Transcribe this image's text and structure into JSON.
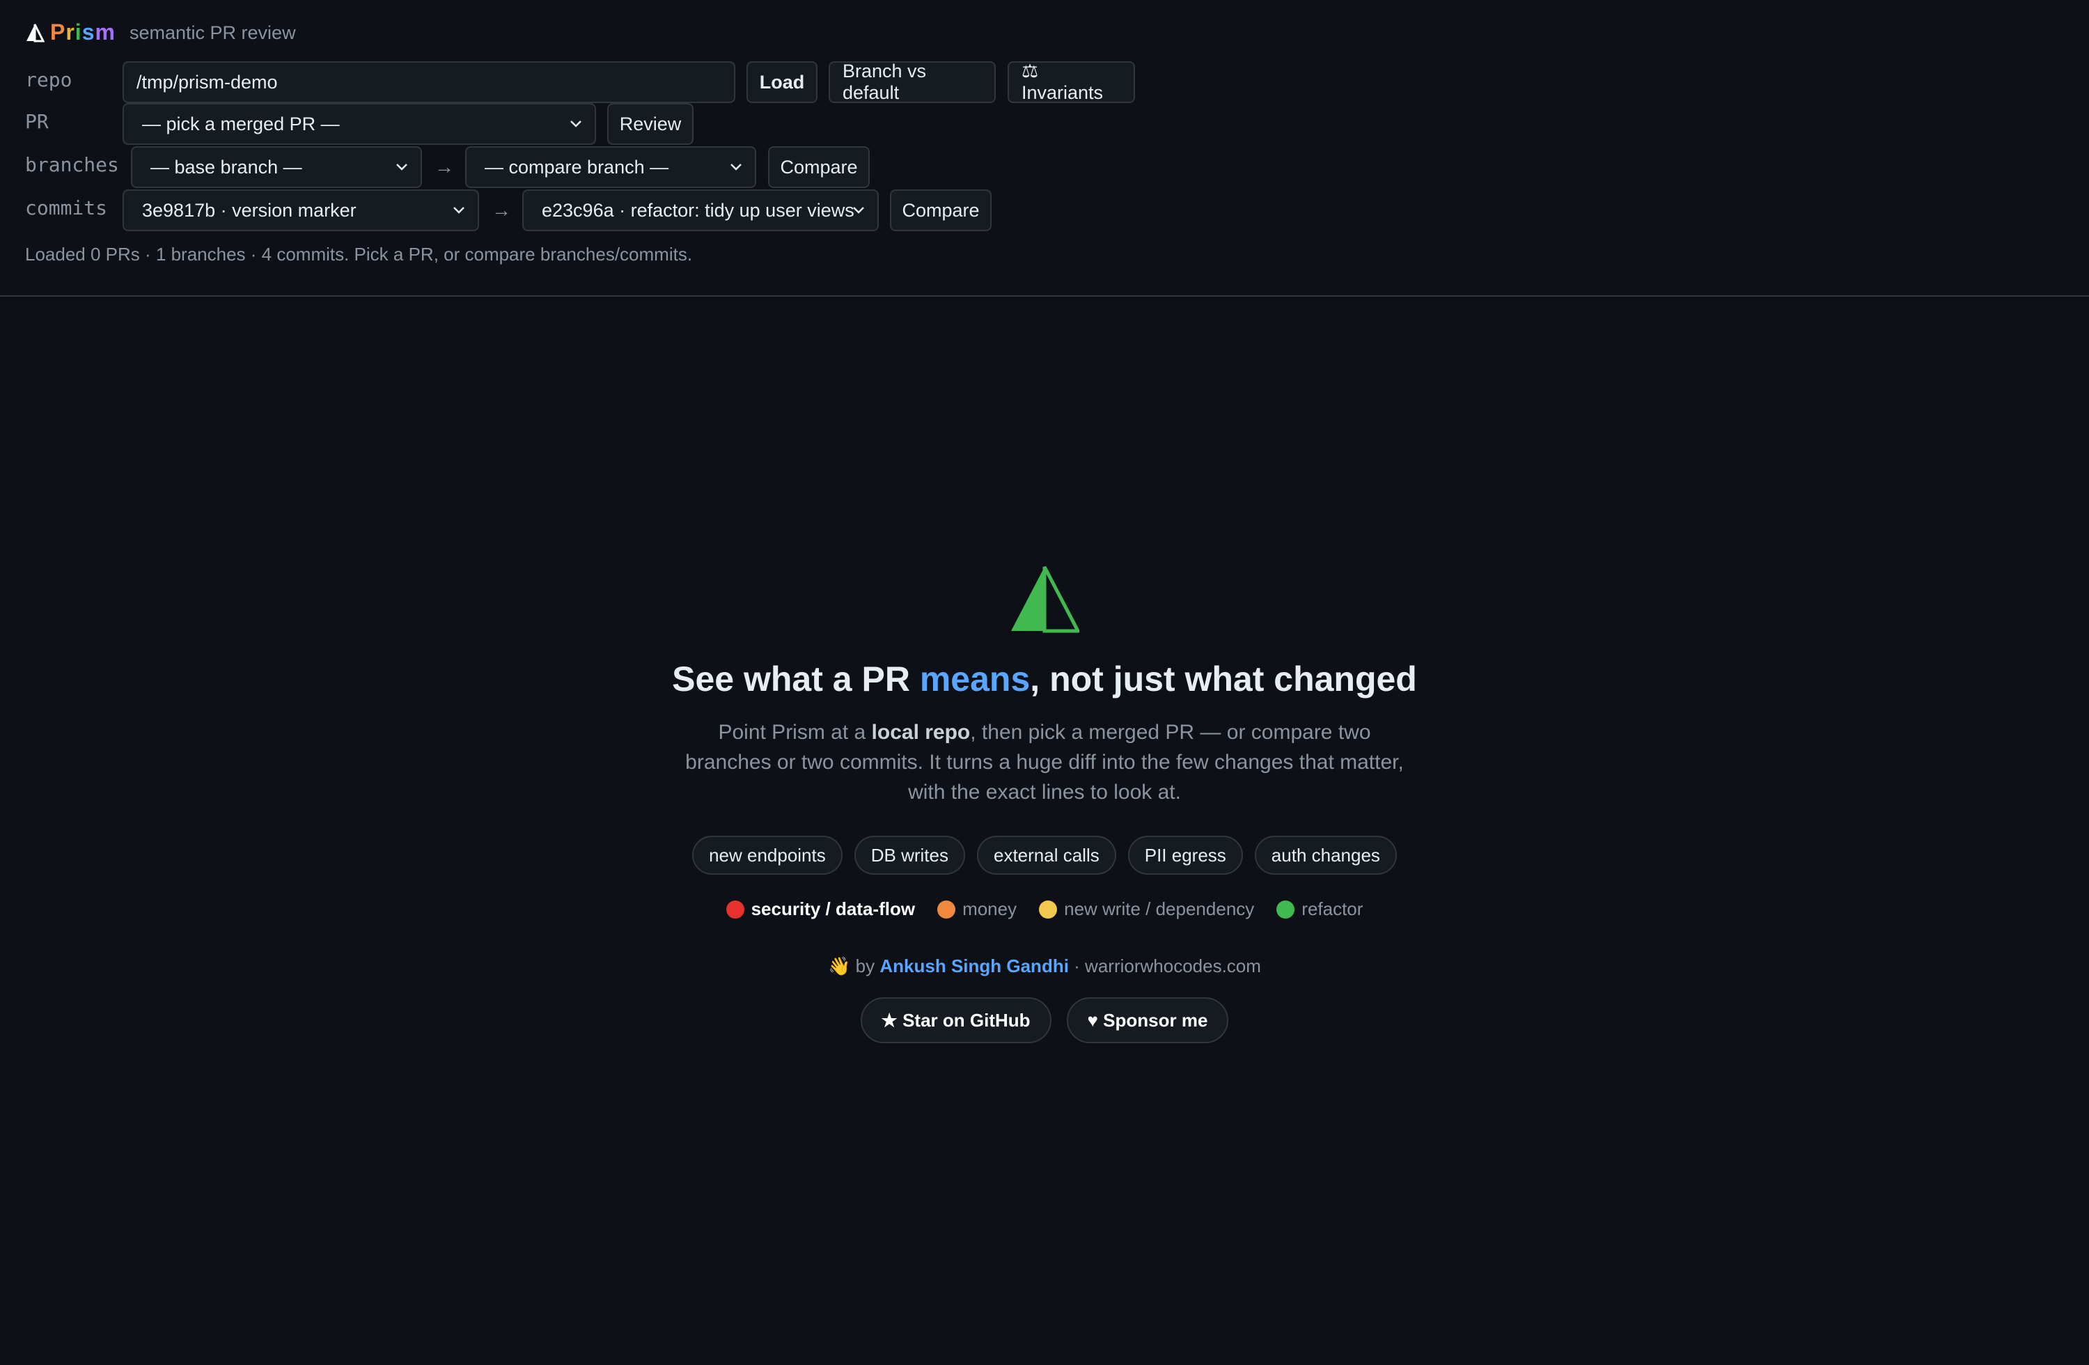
{
  "colors": {
    "bg": "#0d1117",
    "panel": "#161b22",
    "border": "#30363d",
    "accent": "#58a6ff",
    "muted": "#8b949e"
  },
  "header": {
    "brand": [
      "P",
      "r",
      "i",
      "s",
      "m"
    ],
    "tagline": "semantic PR review"
  },
  "form": {
    "repo": {
      "label": "repo",
      "value": "/tmp/prism-demo",
      "load": "Load",
      "branch_vs_default": "Branch vs default",
      "invariants": "⚖ Invariants"
    },
    "pr": {
      "label": "PR",
      "selected": "— pick a merged PR —",
      "review": "Review"
    },
    "branches": {
      "label": "branches",
      "base": "— base branch —",
      "arrow": "→",
      "compare_branch": "— compare branch —",
      "compare": "Compare"
    },
    "commits": {
      "label": "commits",
      "from": "3e9817b · version marker",
      "arrow": "→",
      "to": "e23c96a · refactor: tidy up user views",
      "compare": "Compare"
    }
  },
  "status": "Loaded 0 PRs · 1 branches · 4 commits. Pick a PR, or compare branches/commits.",
  "hero": {
    "headline_pre": "See what a PR ",
    "headline_accent": "means",
    "headline_post": ", not just what changed",
    "desc_1": "Point Prism at a ",
    "desc_bold": "local repo",
    "desc_2": ", then pick a merged PR — or compare two branches or two commits. It turns a huge diff into the few changes that matter, with the exact lines to look at.",
    "chips": [
      "new endpoints",
      "DB writes",
      "external calls",
      "PII egress",
      "auth changes"
    ],
    "legend": [
      {
        "label": "security / data-flow",
        "color": "#e5322d"
      },
      {
        "label": "money",
        "color": "#f0883e"
      },
      {
        "label": "new write / dependency",
        "color": "#f2c94c"
      },
      {
        "label": "refactor",
        "color": "#3fb950"
      }
    ],
    "byline_wave": "👋",
    "byline_by": "by",
    "byline_author": "Ankush Singh Gandhi",
    "byline_site": "· warriorwhocodes.com",
    "star": "★ Star on GitHub",
    "sponsor": "♥ Sponsor me"
  }
}
